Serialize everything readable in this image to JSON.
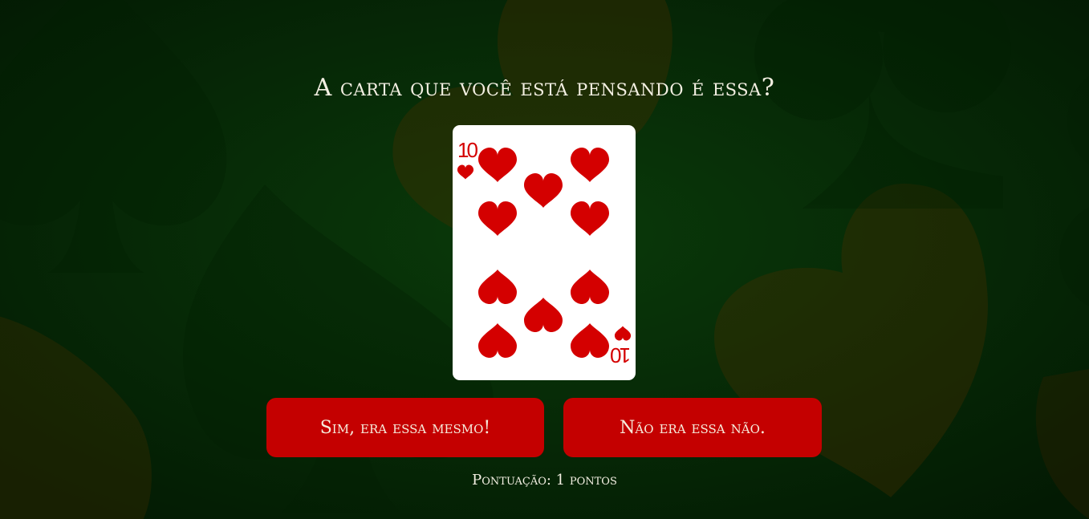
{
  "game": {
    "question": "A carta que você está pensando é essa?",
    "card": {
      "rank": "10",
      "suit": "hearts",
      "suit_color": "#d40000"
    },
    "yes_button_label": "Sim, era essa mesmo!",
    "no_button_label": "Não era essa não.",
    "score_text": "Pontuação: 1 pontos"
  },
  "colors": {
    "background": "#072d07",
    "button": "#c40000",
    "text": "#f3efe2"
  },
  "background_icons": [
    "spade-icon",
    "heart-icon",
    "club-icon"
  ]
}
